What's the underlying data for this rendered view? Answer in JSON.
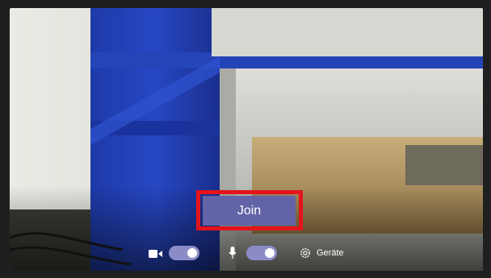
{
  "join": {
    "label": "Join"
  },
  "controls": {
    "camera": {
      "icon": "camera-icon",
      "on": true
    },
    "microphone": {
      "icon": "microphone-icon",
      "on": true
    },
    "devices": {
      "icon": "gear-icon",
      "label": "Geräte"
    }
  },
  "colors": {
    "accent": "#6264a7",
    "toggle_on": "#8b8cc7",
    "highlight": "#e4141b"
  }
}
